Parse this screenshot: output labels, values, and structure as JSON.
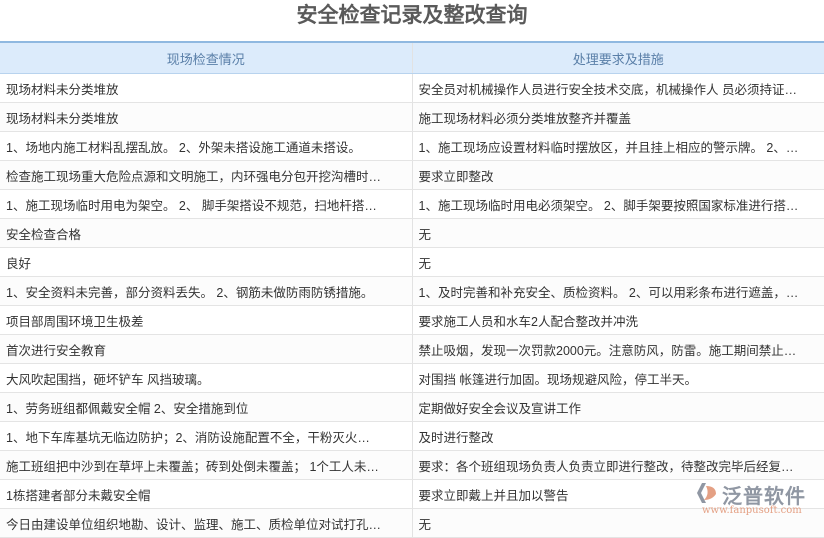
{
  "title": "安全检查记录及整改查询",
  "columns": [
    "现场检查情况",
    "处理要求及措施"
  ],
  "rows": [
    [
      "现场材料未分类堆放",
      "安全员对机械操作人员进行安全技术交底，机械操作人 员必须持证…"
    ],
    [
      "现场材料未分类堆放",
      "施工现场材料必须分类堆放整齐并覆盖"
    ],
    [
      "1、场地内施工材料乱摆乱放。 2、外架未搭设施工通道未搭设。",
      "1、施工现场应设置材料临时摆放区，并且挂上相应的警示牌。 2、…"
    ],
    [
      "检查施工现场重大危险点源和文明施工，内环强电分包开挖沟槽时…",
      "要求立即整改"
    ],
    [
      "1、施工现场临时用电为架空。 2、 脚手架搭设不规范，扫地杆搭…",
      "1、施工现场临时用电必须架空。 2、脚手架要按照国家标准进行搭…"
    ],
    [
      "安全检查合格",
      "无"
    ],
    [
      "良好",
      "无"
    ],
    [
      "1、安全资料未完善，部分资料丢失。 2、钢筋未做防雨防锈措施。",
      "1、及时完善和补充安全、质检资料。 2、可以用彩条布进行遮盖，…"
    ],
    [
      "项目部周围环境卫生极差",
      "要求施工人员和水车2人配合整改并冲洗"
    ],
    [
      "首次进行安全教育",
      "禁止吸烟，发现一次罚款2000元。注意防风，防雷。施工期间禁止…"
    ],
    [
      "大风吹起围挡，砸坏铲车 风挡玻璃。",
      "对围挡 帐篷进行加固。现场规避风险，停工半天。"
    ],
    [
      "1、劳务班组都佩戴安全帽 2、安全措施到位",
      "定期做好安全会议及宣讲工作"
    ],
    [
      "1、地下车库基坑无临边防护；2、消防设施配置不全，干粉灭火…",
      "及时进行整改"
    ],
    [
      "施工班组把中沙到在草坪上未覆盖；砖到处倒未覆盖； 1个工人未…",
      "要求：各个班组现场负责人负责立即进行整改，待整改完毕后经复…"
    ],
    [
      "1栋搭建者部分未戴安全帽",
      "要求立即戴上并且加以警告"
    ],
    [
      "今日由建设单位组织地勘、设计、监理、施工、质检单位对试打孔…",
      "无"
    ]
  ],
  "watermark": {
    "name": "泛普软件",
    "url": "www.fanpusoft.com"
  }
}
